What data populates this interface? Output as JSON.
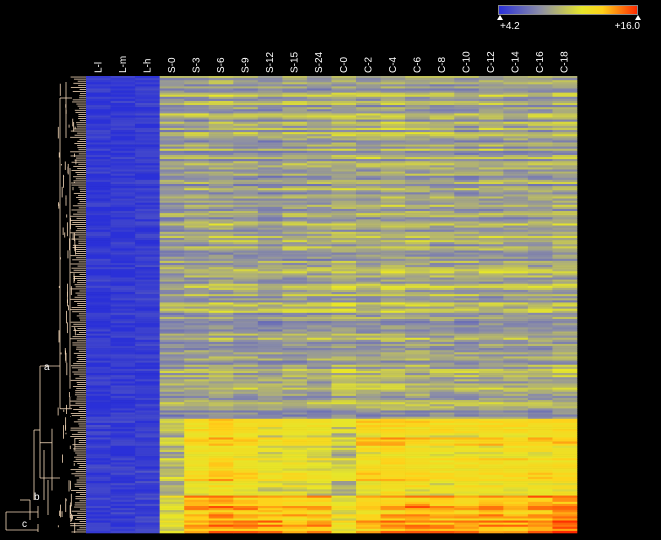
{
  "colors": {
    "background": "#000000",
    "low": "#2a30d8",
    "mid_low": "#8c8ea6",
    "mid": "#e6e62a",
    "high": "#ffd21a",
    "max": "#ff2a00",
    "dendrogram": "#f3d7b8"
  },
  "legend": {
    "min_label": "+4.2",
    "max_label": "+16.0"
  },
  "chart_data": {
    "type": "heatmap",
    "columns": [
      "L-l",
      "L-m",
      "L-h",
      "S-0",
      "S-3",
      "S-6",
      "S-9",
      "S-12",
      "S-15",
      "S-24",
      "C-0",
      "C-2",
      "C-4",
      "C-6",
      "C-8",
      "C-10",
      "C-12",
      "C-14",
      "C-16",
      "C-18"
    ],
    "value_range": [
      4.2,
      16.0
    ],
    "cluster_labels": [
      "a",
      "b",
      "c"
    ],
    "row_count": 220,
    "cluster_profiles": [
      {
        "name": "a",
        "rows_fraction": 0.75,
        "column_means": [
          4.6,
          4.6,
          4.8,
          9.0,
          9.2,
          9.4,
          9.2,
          9.0,
          9.3,
          9.2,
          9.6,
          9.3,
          9.6,
          9.4,
          9.3,
          9.2,
          9.4,
          9.3,
          9.3,
          9.5
        ]
      },
      {
        "name": "b",
        "rows_fraction": 0.17,
        "column_means": [
          4.8,
          4.8,
          5.0,
          10.0,
          12.2,
          13.0,
          12.4,
          11.6,
          11.6,
          11.4,
          10.4,
          12.4,
          12.8,
          12.4,
          12.0,
          12.2,
          12.2,
          12.2,
          12.4,
          12.6
        ]
      },
      {
        "name": "c",
        "rows_fraction": 0.08,
        "column_means": [
          4.8,
          4.8,
          5.0,
          11.0,
          13.8,
          14.4,
          14.0,
          13.8,
          13.4,
          13.6,
          12.0,
          13.2,
          13.8,
          14.0,
          13.8,
          13.8,
          14.0,
          13.8,
          14.2,
          14.6
        ]
      }
    ]
  }
}
